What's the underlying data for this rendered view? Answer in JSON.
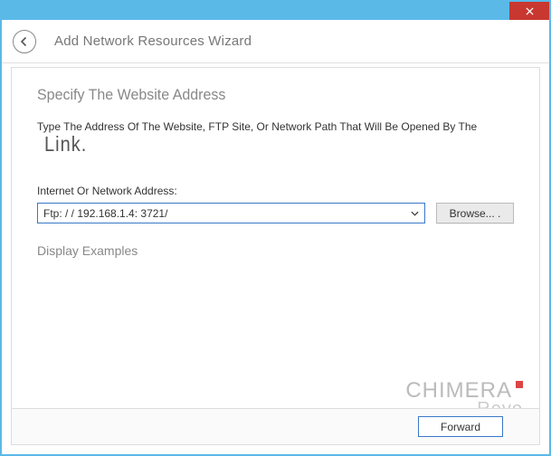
{
  "window": {
    "title": "Add Network Resources Wizard"
  },
  "page": {
    "heading": "Specify The Website Address",
    "instruction": "Type The Address Of The Website, FTP Site, Or Network Path That Will Be Opened By The",
    "instruction_trail": "Link.",
    "field_label": "Internet Or Network Address:",
    "address_value": "Ftp: / / 192.168.1.4: 3721/",
    "browse_label": "Browse... .",
    "examples_label": "Display Examples"
  },
  "footer": {
    "forward_label": "Forward"
  },
  "watermark": {
    "line1": "CHIMERA",
    "line2": "Revo"
  }
}
